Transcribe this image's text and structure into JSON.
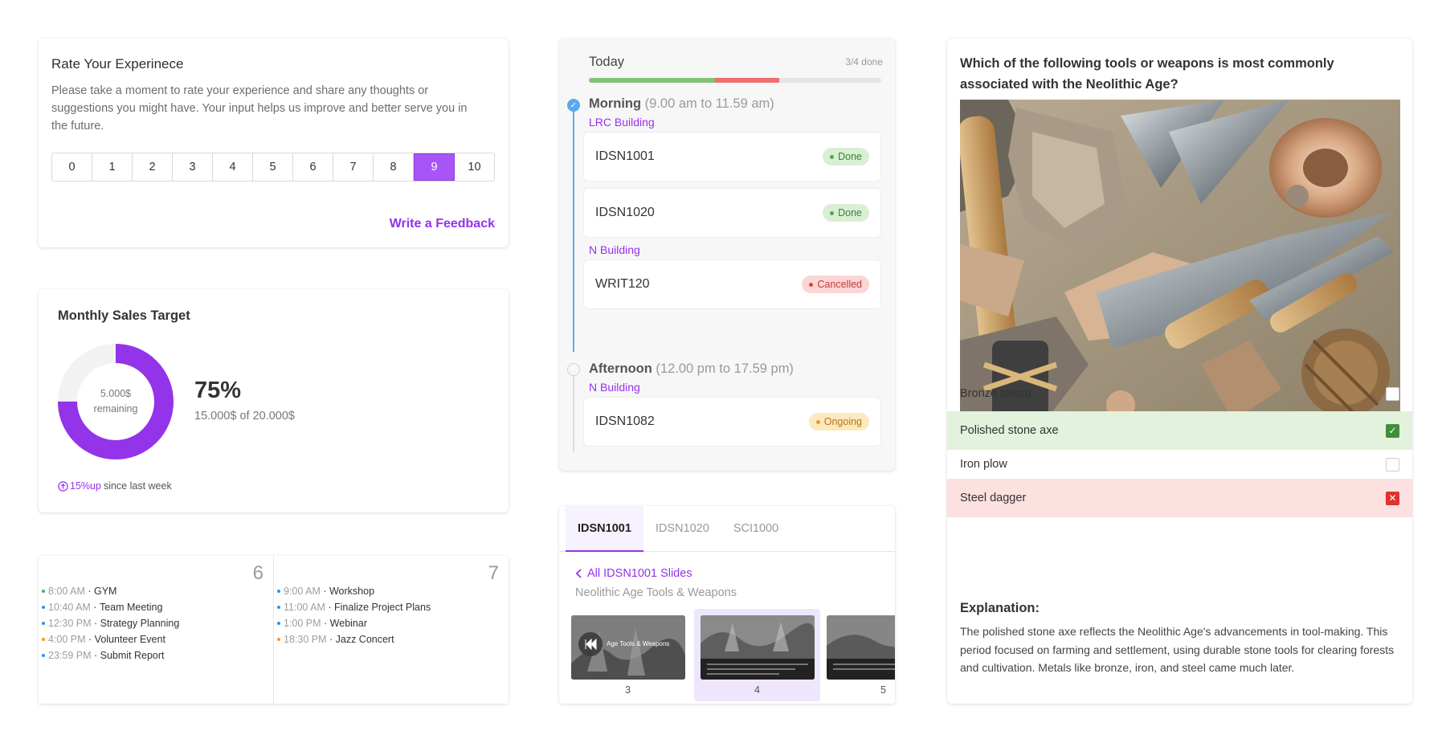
{
  "rating": {
    "title": "Rate Your Experinece",
    "description": "Please take a moment to rate your experience and share any thoughts or suggestions you might have. Your input helps us improve and better serve you in the future.",
    "scale": [
      "0",
      "1",
      "2",
      "3",
      "4",
      "5",
      "6",
      "7",
      "8",
      "9",
      "10"
    ],
    "selected": "9",
    "feedback_link": "Write a Feedback"
  },
  "sales": {
    "title": "Monthly Sales Target",
    "remaining_amount": "5.000$",
    "remaining_label": "remaining",
    "percent": "75%",
    "progress_value": 0.75,
    "detail": "15.000$ of 20.000$",
    "trend_value": "15%up",
    "trend_suffix": "since last week",
    "accent": "#9333ea"
  },
  "calendar": {
    "days": [
      {
        "number": "6",
        "events": [
          {
            "time": "8:00 AM",
            "title": "GYM",
            "color": "#4caf50"
          },
          {
            "time": "10:40 AM",
            "title": "Team Meeting",
            "color": "#2196f3"
          },
          {
            "time": "12:30 PM",
            "title": "Strategy Planning",
            "color": "#2196f3"
          },
          {
            "time": "4:00 PM",
            "title": "Volunteer Event",
            "color": "#ff9800"
          },
          {
            "time": "23:59 PM",
            "title": "Submit Report",
            "color": "#2196f3"
          }
        ]
      },
      {
        "number": "7",
        "events": [
          {
            "time": "9:00 AM",
            "title": "Workshop",
            "color": "#2196f3"
          },
          {
            "time": "11:00 AM",
            "title": "Finalize Project Plans",
            "color": "#2196f3"
          },
          {
            "time": "1:00 PM",
            "title": "Webinar",
            "color": "#2196f3"
          },
          {
            "time": "18:30 PM",
            "title": "Jazz Concert",
            "color": "#ff9800"
          }
        ]
      }
    ]
  },
  "schedule": {
    "title": "Today",
    "done_count": "3/4 done",
    "progress_done": 0.43,
    "progress_cancelled": 0.22,
    "periods": [
      {
        "name": "Morning",
        "hours": "(9.00 am to 11.59 am)"
      },
      {
        "name": "Afternoon",
        "hours": "(12.00 pm to 17.59 pm)"
      }
    ],
    "buildings": [
      "LRC Building",
      "N Building",
      "N Building"
    ],
    "courses": [
      {
        "code": "IDSN1001",
        "status": "Done"
      },
      {
        "code": "IDSN1020",
        "status": "Done"
      },
      {
        "code": "WRIT120",
        "status": "Cancelled"
      },
      {
        "code": "IDSN1082",
        "status": "Ongoing"
      }
    ],
    "status_colors": {
      "Done": {
        "bg": "#d9efd4",
        "fg": "#3d7f37",
        "dot": "#52a84a"
      },
      "Cancelled": {
        "bg": "#fcd5d5",
        "fg": "#c43b3b",
        "dot": "#e0413e"
      },
      "Ongoing": {
        "bg": "#fde9bf",
        "fg": "#b77510",
        "dot": "#e59e1c"
      }
    }
  },
  "slides": {
    "tabs": [
      "IDSN1001",
      "IDSN1020",
      "SCI1000"
    ],
    "active_tab": "IDSN1001",
    "back_link": "All IDSN1001 Slides",
    "subtitle": "Neolithic Age Tools & Weapons",
    "thumbs": [
      "3",
      "4",
      "5"
    ],
    "thumb_caption": "Age Tools & Weapons",
    "selected_thumb": "4"
  },
  "quiz": {
    "question": "Which of the following tools or weapons is most commonly associated with the Neolithic Age?",
    "options": [
      {
        "label": "Bronze sword",
        "state": "none"
      },
      {
        "label": "Polished stone axe",
        "state": "correct"
      },
      {
        "label": "Iron plow",
        "state": "none"
      },
      {
        "label": "Steel dagger",
        "state": "wrong"
      }
    ],
    "explanation_title": "Explanation:",
    "explanation": "The polished stone axe reflects the Neolithic Age's advancements in tool-making. This period focused on farming and settlement, using durable stone tools for clearing forests and cultivation. Metals like bronze, iron, and steel came much later."
  }
}
